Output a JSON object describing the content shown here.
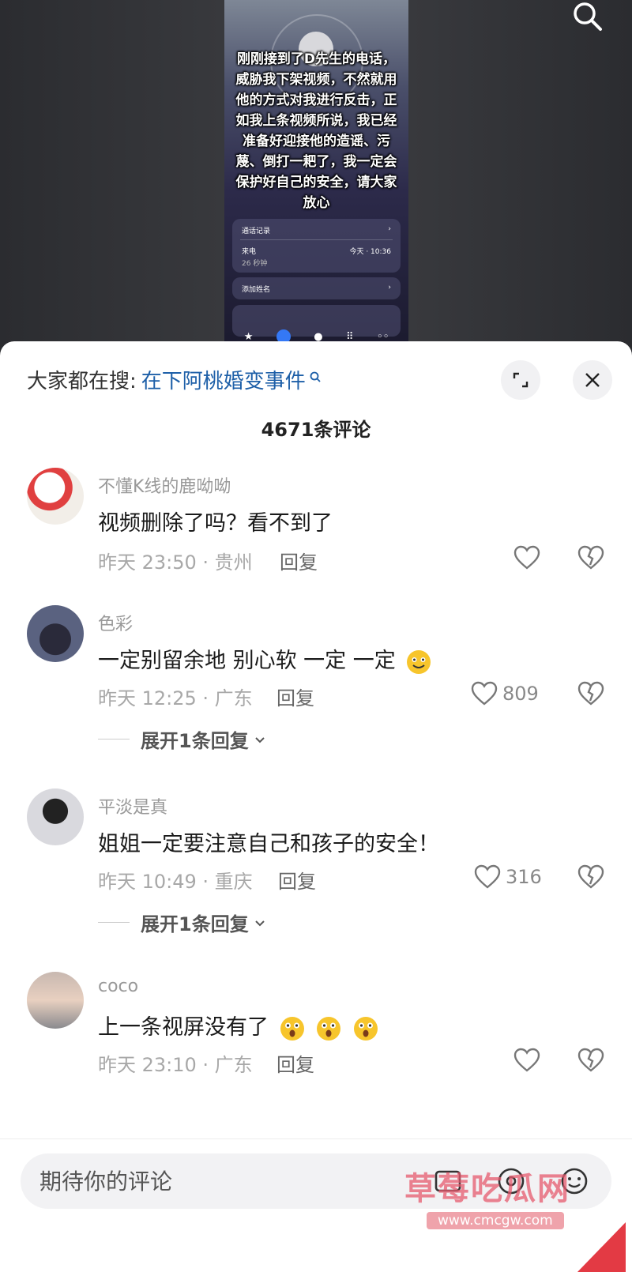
{
  "video": {
    "overlay_text": "刚刚接到了D先生的电话，威胁我下架视频，不然就用他的方式对我进行反击，正如我上条视频所说，我已经准备好迎接他的造谣、污蔑、倒打一耙了，我一定会保护好自己的安全，请大家放心",
    "call_log_label": "通话记录",
    "call_type": "来电",
    "call_time": "今天 · 10:36",
    "call_duration": "26 秒钟",
    "add_name_label": "添加姓名"
  },
  "header": {
    "hot_search_label": "大家都在搜:",
    "hot_search_link": "在下阿桃婚变事件",
    "comment_count": "4671条评论"
  },
  "comments": [
    {
      "user": "不懂K线的鹿呦呦",
      "text": "视频删除了吗？看不到了",
      "meta": "昨天 23:50 · 贵州",
      "reply": "回复",
      "likes": "",
      "expand": ""
    },
    {
      "user": "色彩",
      "text": "一定别留余地 别心软 一定 一定",
      "meta": "昨天 12:25 · 广东",
      "reply": "回复",
      "likes": "809",
      "expand": "展开1条回复"
    },
    {
      "user": "平淡是真",
      "text": "姐姐一定要注意自己和孩子的安全！",
      "meta": "昨天 10:49 · 重庆",
      "reply": "回复",
      "likes": "316",
      "expand": "展开1条回复"
    },
    {
      "user": "coco",
      "text": "上一条视屏没有了",
      "meta": "昨天 23:10 · 广东",
      "reply": "回复",
      "likes": "",
      "expand": ""
    }
  ],
  "input": {
    "placeholder": "期待你的评论"
  },
  "watermark": {
    "text": "草莓吃瓜网",
    "url": "www.cmcgw.com"
  },
  "colors": {
    "link": "#1d5fa8",
    "watermark": "#e65a6e",
    "dock_active": "#3478f6"
  },
  "icons": [
    "search-icon",
    "expand-icon",
    "close-icon",
    "heart-icon",
    "broken-heart-icon",
    "chevron-down-icon",
    "emoji-icon",
    "at-icon"
  ]
}
